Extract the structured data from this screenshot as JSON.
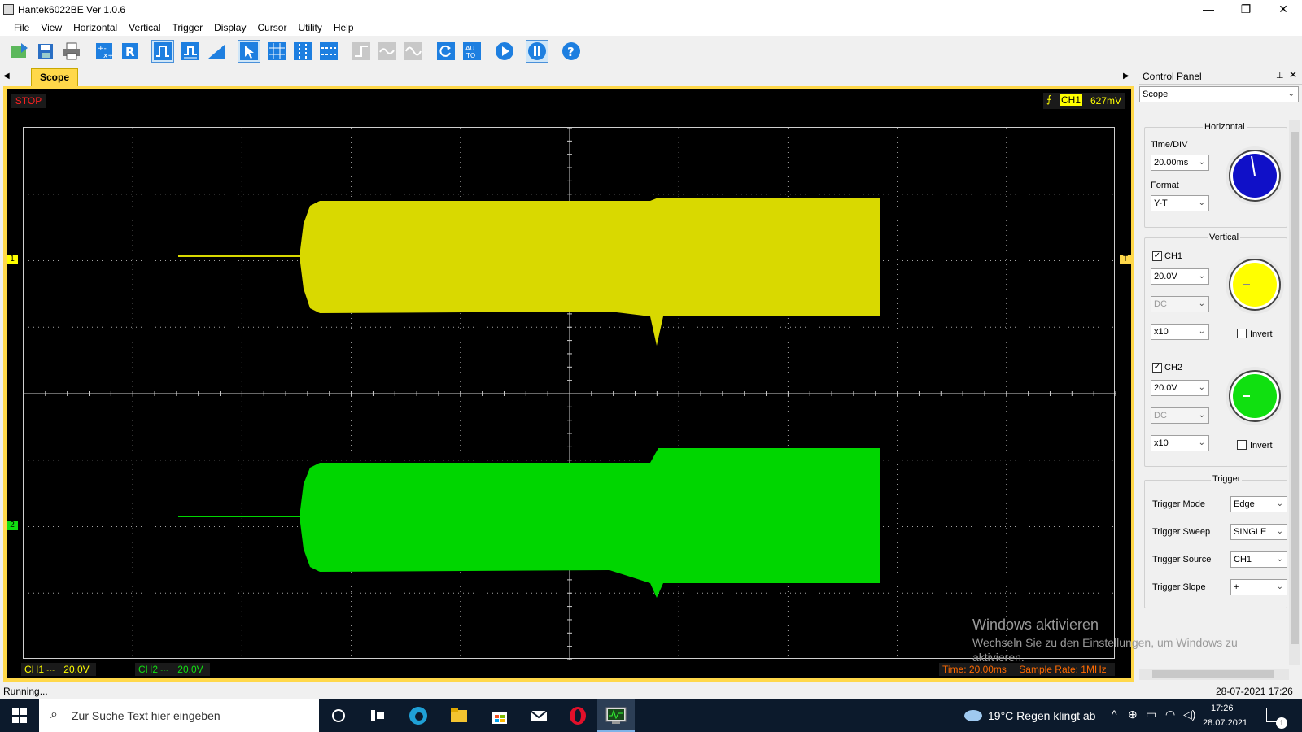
{
  "app": {
    "title": "Hantek6022BE Ver 1.0.6"
  },
  "window_controls": {
    "minimize": "—",
    "maximize": "❐",
    "close": "✕"
  },
  "menu": [
    "File",
    "View",
    "Horizontal",
    "Vertical",
    "Trigger",
    "Display",
    "Cursor",
    "Utility",
    "Help"
  ],
  "toolbar_icons": [
    "open-icon",
    "save-icon",
    "print-icon",
    "measure-icon",
    "reference-icon",
    "pulse-icon",
    "pulse-alt-icon",
    "ramp-icon",
    "select-cursor-icon",
    "grid-icon",
    "vertical-cursor-icon",
    "horizontal-cursor-icon",
    "step-icon",
    "wave-icon",
    "sine-icon",
    "refresh-icon",
    "auto-icon",
    "run-icon",
    "pause-icon",
    "help-icon"
  ],
  "tab": {
    "label": "Scope"
  },
  "scope": {
    "status": "STOP",
    "trigger_channel": "CH1",
    "trigger_level": "627mV",
    "ch1_marker": "1",
    "ch2_marker": "2",
    "trigger_marker": "T",
    "ch1_info_label": "CH1 ⎓",
    "ch1_info_value": "20.0V",
    "ch2_info_label": "CH2 ⎓",
    "ch2_info_value": "20.0V",
    "time_info": "Time: 20.00ms",
    "sample_rate": "Sample Rate: 1MHz",
    "colors": {
      "ch1": "#d9d900",
      "ch2": "#00d600",
      "grid": "#cfcfcf",
      "stop": "#ff2020"
    },
    "grid_divisions": {
      "x": 10,
      "y": 8
    }
  },
  "panel": {
    "title": "Control Panel",
    "mode_select": "Scope",
    "horizontal": {
      "group_label": "Horizontal",
      "timediv_label": "Time/DIV",
      "timediv_value": "20.00ms",
      "format_label": "Format",
      "format_value": "Y-T"
    },
    "vertical": {
      "group_label": "Vertical",
      "ch1": {
        "label": "CH1",
        "checked": true,
        "volts": "20.0V",
        "coupling": "DC",
        "probe": "x10",
        "invert_label": "Invert"
      },
      "ch2": {
        "label": "CH2",
        "checked": true,
        "volts": "20.0V",
        "coupling": "DC",
        "probe": "x10",
        "invert_label": "Invert"
      }
    },
    "trigger": {
      "group_label": "Trigger",
      "mode_label": "Trigger Mode",
      "mode_value": "Edge",
      "sweep_label": "Trigger Sweep",
      "sweep_value": "SINGLE",
      "source_label": "Trigger Source",
      "source_value": "CH1",
      "slope_label": "Trigger Slope",
      "slope_value": "+"
    },
    "knob_colors": {
      "time": "#1010c8",
      "ch1": "#ffff00",
      "ch2": "#10e010"
    }
  },
  "watermark": {
    "line1": "Windows aktivieren",
    "line2": "Wechseln Sie zu den Einstellungen, um Windows zu",
    "line3": "aktivieren."
  },
  "status": {
    "left": "Running...",
    "datetime": "28-07-2021  17:26"
  },
  "taskbar": {
    "search_placeholder": "Zur Suche Text hier eingeben",
    "weather": "19°C  Regen klingt ab",
    "time": "17:26",
    "date": "28.07.2021",
    "notification_count": "1"
  }
}
